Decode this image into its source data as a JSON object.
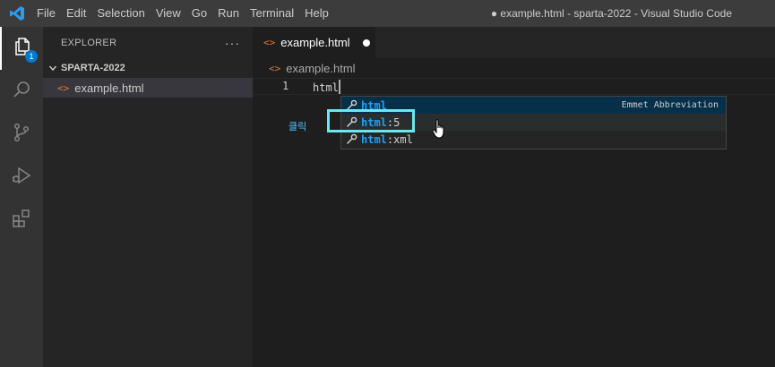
{
  "menu": [
    "File",
    "Edit",
    "Selection",
    "View",
    "Go",
    "Run",
    "Terminal",
    "Help"
  ],
  "window_title": "● example.html - sparta-2022 - Visual Studio Code",
  "activity": {
    "explorer_badge": "1"
  },
  "sidebar": {
    "header": "EXPLORER",
    "more": "···",
    "folder": "SPARTA-2022",
    "file": "example.html",
    "file_icon": "<>"
  },
  "editor": {
    "tab_label": "example.html",
    "tab_icon": "<>",
    "breadcrumb": "example.html",
    "breadcrumb_icon": "<>",
    "line_number": "1",
    "code": "html"
  },
  "suggestions": [
    {
      "match": "html",
      "rest": "",
      "detail": "Emmet Abbreviation"
    },
    {
      "match": "html",
      "rest": ":5",
      "detail": ""
    },
    {
      "match": "html",
      "rest": ":xml",
      "detail": ""
    }
  ],
  "annotation": "클릭",
  "colors": {
    "accent": "#007acc",
    "highlight": "#68e8f0",
    "match": "#18a3ff",
    "file_icon": "#e37933"
  }
}
